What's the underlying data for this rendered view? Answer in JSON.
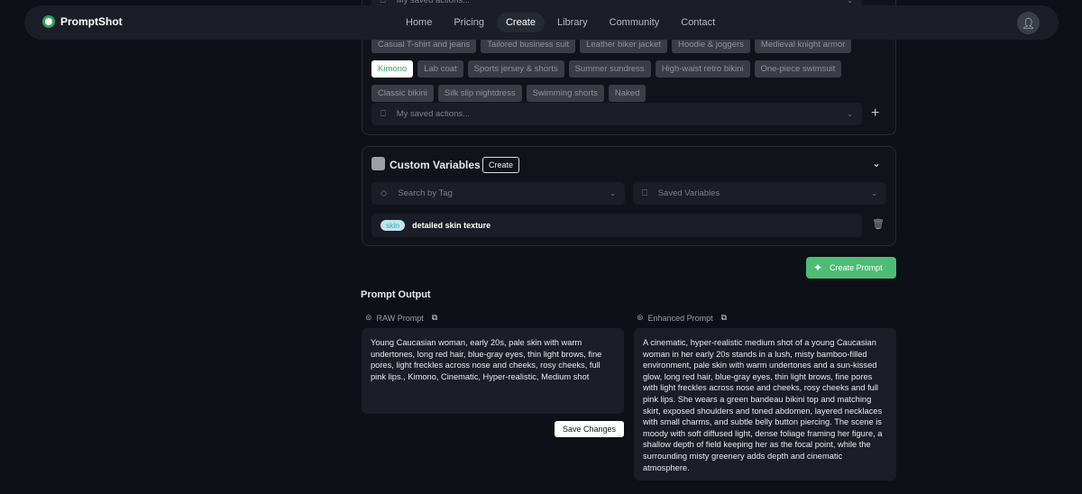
{
  "nav": {
    "brand": "PromptShot",
    "links": [
      "Home",
      "Pricing",
      "Create",
      "Library",
      "Community",
      "Contact"
    ],
    "active": "Create"
  },
  "outfit_tags": {
    "row1": [
      "Casual T-shirt and jeans",
      "Tailored business suit",
      "Leather biker jacket",
      "Hoodie & joggers",
      "Medieval knight armor"
    ],
    "row2": [
      "Kimono",
      "Lab coat",
      "Sports jersey & shorts",
      "Summer sundress",
      "High-waist retro bikini",
      "One-piece swimsuit"
    ],
    "row3": [
      "Classic bikini",
      "Silk slip nightdress",
      "Swimming shorts",
      "Naked"
    ],
    "selected": "Kimono"
  },
  "saved_actions": {
    "placeholder": "My saved actions..."
  },
  "custom_variables": {
    "title": "Custom Variables",
    "create_label": "Create",
    "search_placeholder": "Search by Tag",
    "saved_placeholder": "Saved Variables",
    "items": [
      {
        "tag": "skin",
        "value": "detailed skin texture"
      }
    ]
  },
  "create_prompt_label": "Create Prompt",
  "output": {
    "title": "Prompt Output",
    "raw_label": "RAW Prompt",
    "enhanced_label": "Enhanced Prompt",
    "raw_text": "Young Caucasian woman, early 20s, pale skin with warm undertones, long red hair, blue-gray eyes, thin light brows, fine pores, light freckles across nose and cheeks, rosy cheeks, full pink lips., Kimono, Cinematic, Hyper-realistic, Medium shot",
    "enhanced_text": "A cinematic, hyper-realistic medium shot of a young Caucasian woman in her early 20s stands in a lush, misty bamboo-filled environment, pale skin with warm undertones and a sun-kissed glow, long red hair, blue-gray eyes, thin light brows, fine pores with light freckles across nose and cheeks, rosy cheeks and full pink lips. She wears a green bandeau bikini top and matching skirt, exposed shoulders and toned abdomen, layered necklaces with small charms, and subtle belly button piercing. The scene is moody with soft diffused light, dense foliage framing her figure, a shallow depth of field keeping her as the focal point, while the surrounding misty greenery adds depth and cinematic atmosphere.",
    "save_label": "Save Changes"
  },
  "colors": {
    "accent": "#4dbd74",
    "background": "#0d1017"
  }
}
